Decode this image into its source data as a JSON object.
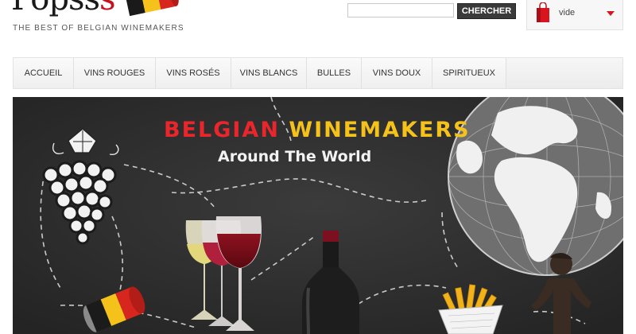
{
  "header": {
    "logo_text_main": "Popss",
    "logo_text_accent": "s",
    "tagline": "THE BEST OF BELGIAN WINEMAKERS"
  },
  "search": {
    "value": "",
    "placeholder": "",
    "button_label": "CHERCHER"
  },
  "cart": {
    "label": "vide"
  },
  "nav": {
    "items": [
      {
        "label": "ACCUEIL"
      },
      {
        "label": "VINS ROUGES"
      },
      {
        "label": "VINS ROSÉS"
      },
      {
        "label": "VINS BLANCS"
      },
      {
        "label": "BULLES"
      },
      {
        "label": "VINS DOUX"
      },
      {
        "label": "SPIRITUEUX"
      }
    ]
  },
  "banner": {
    "title_word1": "BELGIAN",
    "title_word2": "WINEMAKERS",
    "subtitle": "Around The World"
  },
  "colors": {
    "brand_red": "#c5121d",
    "belgian_yellow": "#f4c21a",
    "chalkboard": "#2f2f2f"
  },
  "icons": [
    "cork-icon",
    "shopping-bag-icon",
    "caret-down-icon",
    "grape-cluster-icon",
    "globe-icon",
    "wine-glass-icon",
    "wine-bottle-icon",
    "fries-icon",
    "statue-icon"
  ]
}
